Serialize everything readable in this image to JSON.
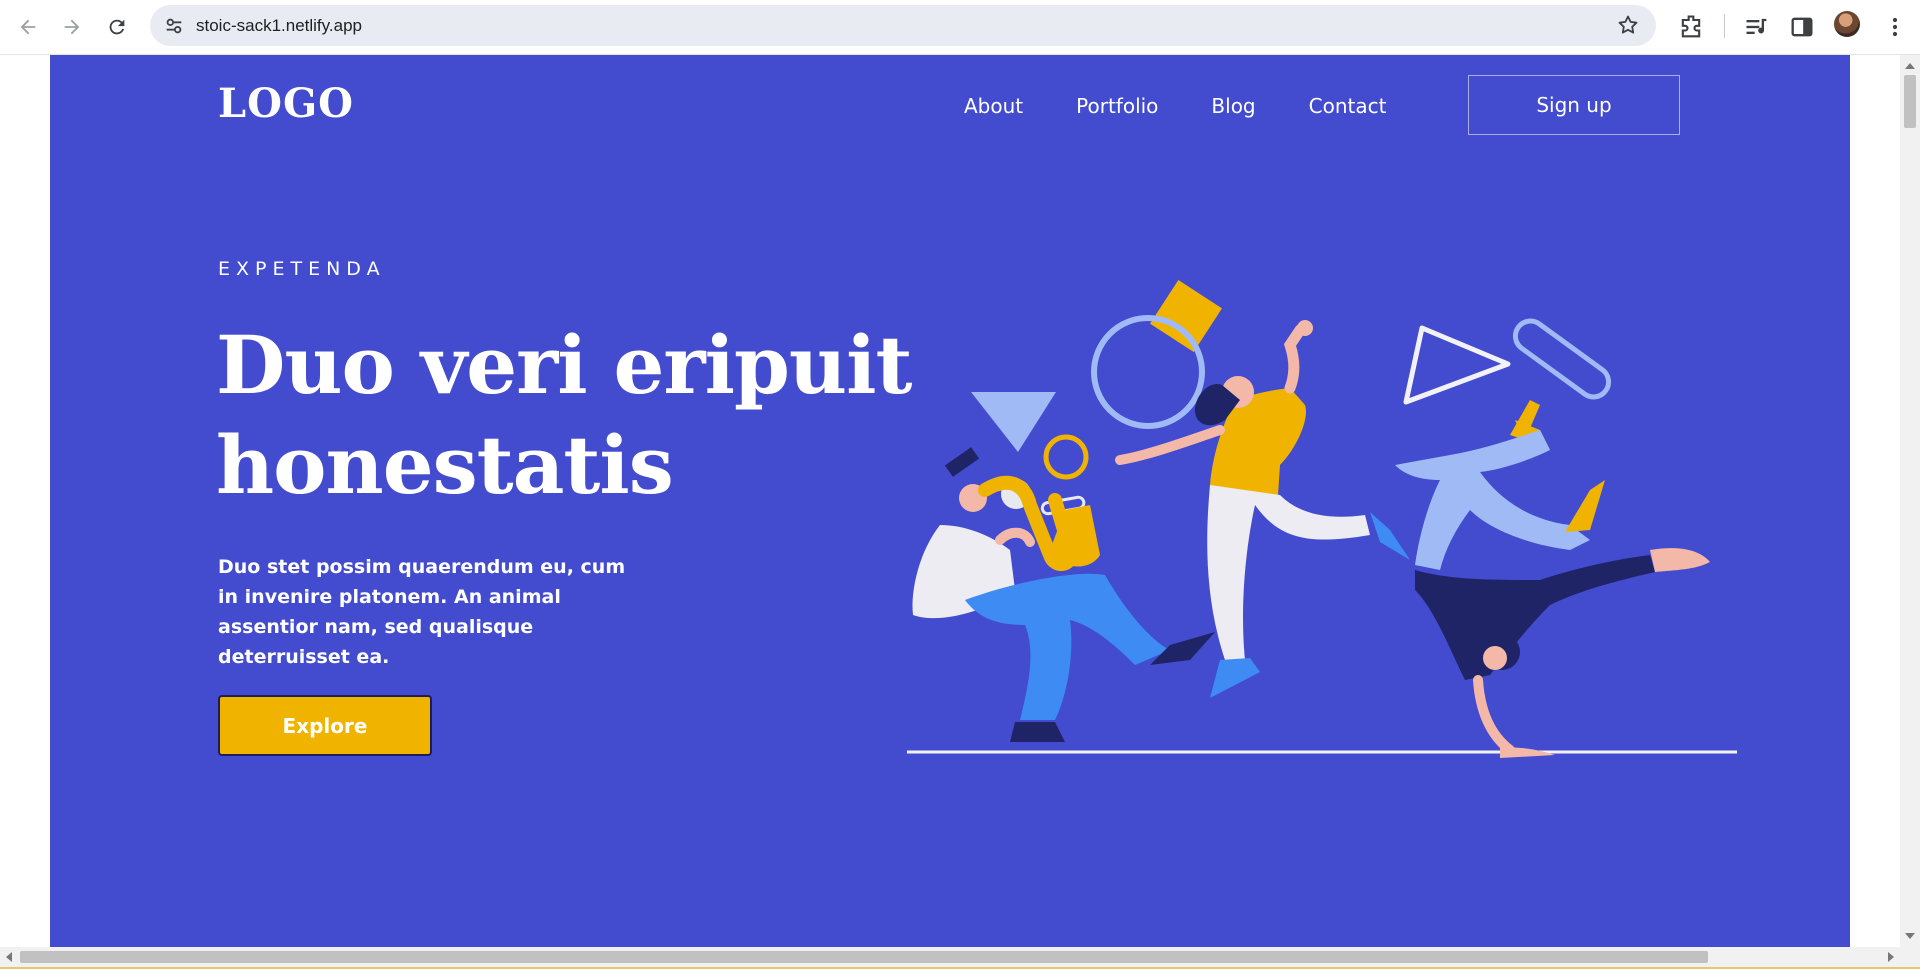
{
  "browser": {
    "url": "stoic-sack1.netlify.app",
    "icons": [
      "back-arrow-icon",
      "forward-arrow-icon",
      "reload-icon",
      "site-settings-icon",
      "bookmark-star-icon",
      "extensions-icon",
      "media-control-icon",
      "side-panel-icon",
      "profile-avatar",
      "more-menu-icon"
    ]
  },
  "site": {
    "logo": "LOGO",
    "nav": [
      "About",
      "Portfolio",
      "Blog",
      "Contact"
    ],
    "signup_label": "Sign up"
  },
  "hero": {
    "eyebrow": "EXPETENDA",
    "headline_line1": "Duo veri eripuit",
    "headline_line2": "honestatis",
    "description": "Duo stet possim quaerendum eu, cum in invenire platonem. An animal assentior nam, sed qualisque deterruisset ea.",
    "cta_label": "Explore"
  },
  "colors": {
    "hero_bg": "#434ccf",
    "accent_yellow": "#f0b400",
    "light_blue": "#9fbaf5",
    "mid_blue": "#3d8bf3",
    "navy": "#1e2466",
    "white": "#ffffff"
  }
}
